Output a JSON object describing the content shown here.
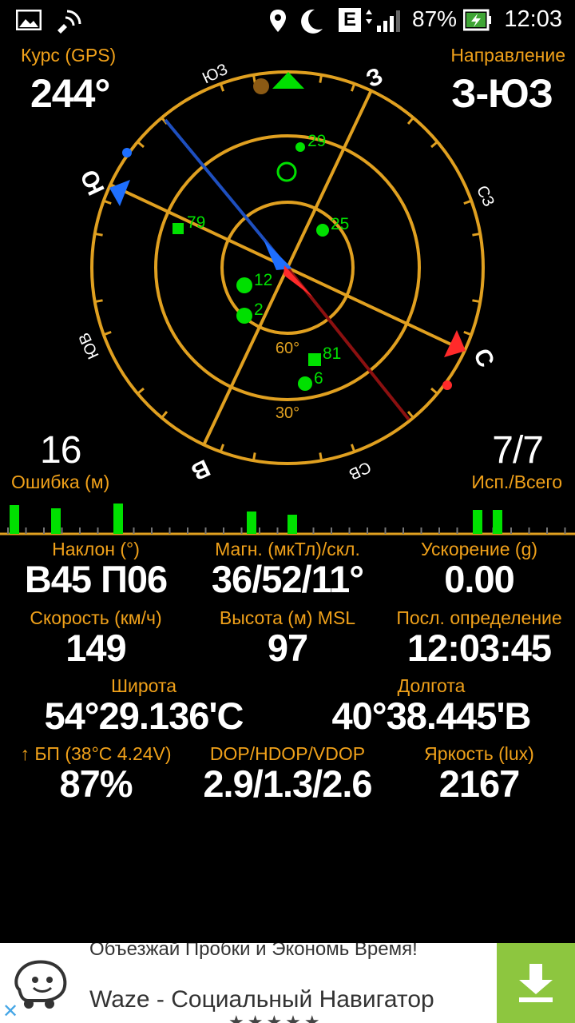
{
  "status_bar": {
    "network_type": "E",
    "battery": "87%",
    "time": "12:03"
  },
  "compass": {
    "course_label": "Курс (GPS)",
    "course_value": "244°",
    "direction_label": "Направление",
    "direction_value": "З-ЮЗ",
    "dir_labels": {
      "n": "С",
      "ne": "СВ",
      "e": "В",
      "se": "ЮВ",
      "s": "Ю",
      "sw": "ЮЗ",
      "w": "З",
      "nw": "СЗ"
    },
    "ring_labels": {
      "inner": "60°",
      "middle": "30°"
    },
    "satellites": [
      {
        "id": "29",
        "shape": "circle"
      },
      {
        "id": "25",
        "shape": "circle"
      },
      {
        "id": "79",
        "shape": "square"
      },
      {
        "id": "12",
        "shape": "circle"
      },
      {
        "id": "2",
        "shape": "circle"
      },
      {
        "id": "81",
        "shape": "square"
      },
      {
        "id": "6",
        "shape": "circle"
      }
    ],
    "error_value": "16",
    "error_label": "Ошибка (м)",
    "used_value": "7/7",
    "used_label": "Исп./Всего"
  },
  "signal_bars": [
    0.9,
    0.8,
    0.95,
    0.7,
    0.6,
    0.75,
    0.75
  ],
  "stats": [
    {
      "label": "Наклон (°)",
      "value": "В45 П06"
    },
    {
      "label": "Магн. (мкТл)/скл.",
      "value": "36/52/11°"
    },
    {
      "label": "Ускорение (g)",
      "value": "0.00"
    },
    {
      "label": "Скорость (км/ч)",
      "value": "149"
    },
    {
      "label": "Высота (м) MSL",
      "value": "97"
    },
    {
      "label": "Посл. определение",
      "value": "12:03:45"
    },
    {
      "label": "Широта",
      "value": "54°29.136'С"
    },
    {
      "label": "Долгота",
      "value": "40°38.445'В"
    },
    {
      "label": "↑ БП (38°C 4.24V)",
      "value": "87%"
    },
    {
      "label": "DOP/HDOP/VDOP",
      "value": "2.9/1.3/2.6"
    },
    {
      "label": "Яркость (lux)",
      "value": "2167"
    }
  ],
  "ad": {
    "tagline": "Объезжай Пробки и Экономь Время!",
    "title": "Waze - Социальный Навигатор",
    "rating_stars": "★★★★★"
  },
  "colors": {
    "accent": "#f0a11a",
    "satellite": "#00e000",
    "sun": "#1e6fff",
    "needle_red": "#ff2a2a",
    "ad_button": "#8dc63f"
  }
}
